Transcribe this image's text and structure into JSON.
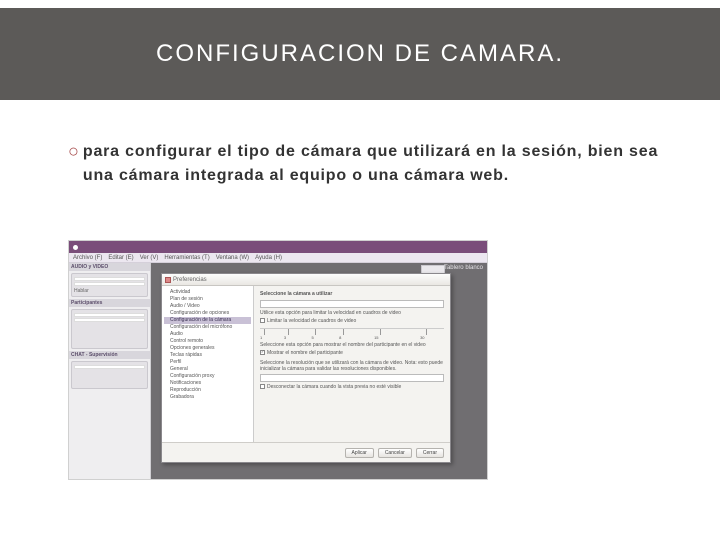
{
  "slide": {
    "title": "CONFIGURACION DE CAMARA.",
    "bullet_text": "para configurar el tipo de cámara que utilizará en la sesión, bien sea una cámara integrada al equipo o una cámara web."
  },
  "app": {
    "title": "",
    "menu": [
      "Archivo (F)",
      "Editar (E)",
      "Ver (V)",
      "Herramientas (T)",
      "Ventana (W)",
      "Ayuda (H)"
    ],
    "panels": {
      "audio_video": "AUDIO y VIDEO",
      "talk": "Hablar",
      "participants": "Participantes",
      "chat": "CHAT - Supervisión"
    },
    "content_header": "Tablero blanco"
  },
  "dialog": {
    "title": "Preferencias",
    "tree": [
      "Actividad",
      "Plan de sesión",
      "Audio / Video",
      "Configuración de opciones",
      "Configuración de la cámara",
      "Configuración del micrófono",
      "Audio",
      "Control remoto",
      "Opciones generales",
      "Teclas rápidas",
      "Perfil",
      "General",
      "Configuración proxy",
      "Notificaciones",
      "Reproducción",
      "Grabadora"
    ],
    "selected": "Configuración de la cámara",
    "right": {
      "heading": "Seleccione la cámara a utilizar",
      "line1": "Utilice esta opción para limitar la velocidad en cuadros de video",
      "checkbox1": "Limitar la velocidad de cuadros de video",
      "scale_values": [
        "1",
        "3",
        "5",
        "8",
        "15",
        "30"
      ],
      "line2": "Seleccione esta opción para mostrar el nombre del participante en el video",
      "checkbox2": "Mostrar el nombre del participante",
      "line3": "Seleccione la resolución que se utilizará con la cámara de video. Nota: esto puede inicializar la cámara para validar las resoluciones disponibles.",
      "checkbox3": "Desconectar la cámara cuando la vista previa no esté visible"
    },
    "buttons": {
      "apply": "Aplicar",
      "cancel": "Cancelar",
      "close": "Cerrar"
    }
  }
}
